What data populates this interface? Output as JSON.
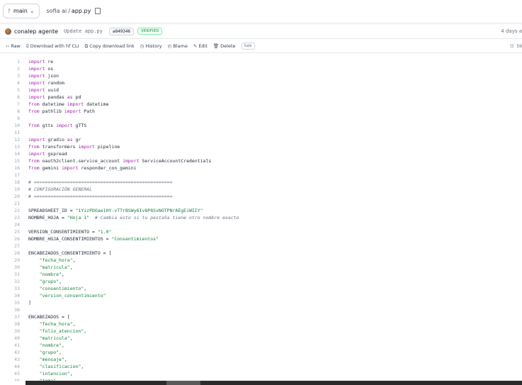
{
  "repo": {
    "branch": "main",
    "path": "sofia ai",
    "separator": "/",
    "file": "app.py"
  },
  "commit": {
    "author": "conalep agente",
    "message": "Update app.py",
    "hash": "a849346",
    "verified": "VERIFIED",
    "date": "4 days a"
  },
  "toolbar": {
    "raw": "Raw",
    "download_cli": "Download with hf CLI",
    "copy_link": "Copy download link",
    "history": "History",
    "blame": "Blame",
    "edit": "Edit",
    "delete": "Delete",
    "safe": "Safe",
    "size": "59"
  },
  "icons": {
    "branch": "git-branch-icon",
    "copy": "copy-icon",
    "raw": "code-icon",
    "download": "download-icon",
    "copy_link": "link-copy-icon",
    "history": "history-icon",
    "blame": "blame-icon",
    "edit": "pencil-icon",
    "delete": "trash-icon"
  },
  "code_lines": [
    [
      {
        "t": "import",
        "k": "kw"
      },
      {
        "t": " re",
        "k": ""
      }
    ],
    [
      {
        "t": "import",
        "k": "kw"
      },
      {
        "t": " os",
        "k": ""
      }
    ],
    [
      {
        "t": "import",
        "k": "kw"
      },
      {
        "t": " json",
        "k": ""
      }
    ],
    [
      {
        "t": "import",
        "k": "kw"
      },
      {
        "t": " random",
        "k": ""
      }
    ],
    [
      {
        "t": "import",
        "k": "kw"
      },
      {
        "t": " uuid",
        "k": ""
      }
    ],
    [
      {
        "t": "import",
        "k": "kw"
      },
      {
        "t": " pandas ",
        "k": ""
      },
      {
        "t": "as",
        "k": "kw"
      },
      {
        "t": " pd",
        "k": ""
      }
    ],
    [
      {
        "t": "from",
        "k": "kw"
      },
      {
        "t": " datetime ",
        "k": ""
      },
      {
        "t": "import",
        "k": "kw"
      },
      {
        "t": " datetime",
        "k": ""
      }
    ],
    [
      {
        "t": "from",
        "k": "kw"
      },
      {
        "t": " pathlib ",
        "k": ""
      },
      {
        "t": "import",
        "k": "kw"
      },
      {
        "t": " Path",
        "k": ""
      }
    ],
    [],
    [
      {
        "t": "from",
        "k": "kw"
      },
      {
        "t": " gtts ",
        "k": ""
      },
      {
        "t": "import",
        "k": "kw"
      },
      {
        "t": " gTTS",
        "k": ""
      }
    ],
    [],
    [
      {
        "t": "import",
        "k": "kw"
      },
      {
        "t": " gradio ",
        "k": ""
      },
      {
        "t": "as",
        "k": "kw"
      },
      {
        "t": " gr",
        "k": ""
      }
    ],
    [
      {
        "t": "from",
        "k": "kw"
      },
      {
        "t": " transformers ",
        "k": ""
      },
      {
        "t": "import",
        "k": "kw"
      },
      {
        "t": " pipeline",
        "k": ""
      }
    ],
    [
      {
        "t": "import",
        "k": "kw"
      },
      {
        "t": " gspread",
        "k": ""
      }
    ],
    [
      {
        "t": "from",
        "k": "kw"
      },
      {
        "t": " oauth2client.service_account ",
        "k": ""
      },
      {
        "t": "import",
        "k": "kw"
      },
      {
        "t": " ServiceAccountCredentials",
        "k": ""
      }
    ],
    [
      {
        "t": "from",
        "k": "kw"
      },
      {
        "t": " gemini ",
        "k": ""
      },
      {
        "t": "import",
        "k": "kw"
      },
      {
        "t": " responder_con_gemini",
        "k": ""
      }
    ],
    [],
    [
      {
        "t": "# ==================================================",
        "k": "cm"
      }
    ],
    [
      {
        "t": "# CONFIGURACIÓN GENERAL",
        "k": "cm"
      }
    ],
    [
      {
        "t": "# ==================================================",
        "k": "cm"
      }
    ],
    [],
    [
      {
        "t": "SPREADSHEET_ID = ",
        "k": ""
      },
      {
        "t": "\"1YizPDOae1HY-vTTrBSWy6Iv8P8SvNOTPNrAEgEiWIIY\"",
        "k": "str"
      }
    ],
    [
      {
        "t": "NOMBRE_HOJA = ",
        "k": ""
      },
      {
        "t": "\"Hoja 1\"",
        "k": "str"
      },
      {
        "t": "  # Cambia esto si tu pestaña tiene otro nombre exacto",
        "k": "cm"
      }
    ],
    [],
    [
      {
        "t": "VERSION_CONSENTIMIENTO = ",
        "k": ""
      },
      {
        "t": "\"1.0\"",
        "k": "str"
      }
    ],
    [
      {
        "t": "NOMBRE_HOJA_CONSENTIMIENTOS = ",
        "k": ""
      },
      {
        "t": "\"Consentimientos\"",
        "k": "str"
      }
    ],
    [],
    [
      {
        "t": "ENCABEZADOS_CONSENTIMIENTO = [",
        "k": ""
      }
    ],
    [
      {
        "t": "    ",
        "k": ""
      },
      {
        "t": "\"fecha_hora\"",
        "k": "str"
      },
      {
        "t": ",",
        "k": ""
      }
    ],
    [
      {
        "t": "    ",
        "k": ""
      },
      {
        "t": "\"matricula\"",
        "k": "str"
      },
      {
        "t": ",",
        "k": ""
      }
    ],
    [
      {
        "t": "    ",
        "k": ""
      },
      {
        "t": "\"nombre\"",
        "k": "str"
      },
      {
        "t": ",",
        "k": ""
      }
    ],
    [
      {
        "t": "    ",
        "k": ""
      },
      {
        "t": "\"grupo\"",
        "k": "str"
      },
      {
        "t": ",",
        "k": ""
      }
    ],
    [
      {
        "t": "    ",
        "k": ""
      },
      {
        "t": "\"consentimiento\"",
        "k": "str"
      },
      {
        "t": ",",
        "k": ""
      }
    ],
    [
      {
        "t": "    ",
        "k": ""
      },
      {
        "t": "\"version_consentimiento\"",
        "k": "str"
      }
    ],
    [
      {
        "t": "]",
        "k": ""
      }
    ],
    [],
    [
      {
        "t": "ENCABEZADOS = [",
        "k": ""
      }
    ],
    [
      {
        "t": "    ",
        "k": ""
      },
      {
        "t": "\"fecha_hora\"",
        "k": "str"
      },
      {
        "t": ",",
        "k": ""
      }
    ],
    [
      {
        "t": "    ",
        "k": ""
      },
      {
        "t": "\"folio_atencion\"",
        "k": "str"
      },
      {
        "t": ",",
        "k": ""
      }
    ],
    [
      {
        "t": "    ",
        "k": ""
      },
      {
        "t": "\"matricula\"",
        "k": "str"
      },
      {
        "t": ",",
        "k": ""
      }
    ],
    [
      {
        "t": "    ",
        "k": ""
      },
      {
        "t": "\"nombre\"",
        "k": "str"
      },
      {
        "t": ",",
        "k": ""
      }
    ],
    [
      {
        "t": "    ",
        "k": ""
      },
      {
        "t": "\"grupo\"",
        "k": "str"
      },
      {
        "t": ",",
        "k": ""
      }
    ],
    [
      {
        "t": "    ",
        "k": ""
      },
      {
        "t": "\"mensaje\"",
        "k": "str"
      },
      {
        "t": ",",
        "k": ""
      }
    ],
    [
      {
        "t": "    ",
        "k": ""
      },
      {
        "t": "\"clasificacion\"",
        "k": "str"
      },
      {
        "t": ",",
        "k": ""
      }
    ],
    [
      {
        "t": "    ",
        "k": ""
      },
      {
        "t": "\"intencion\"",
        "k": "str"
      },
      {
        "t": ",",
        "k": ""
      }
    ],
    [
      {
        "t": "    ",
        "k": ""
      },
      {
        "t": "\"tema\"",
        "k": "str"
      },
      {
        "t": ",",
        "k": ""
      }
    ]
  ]
}
